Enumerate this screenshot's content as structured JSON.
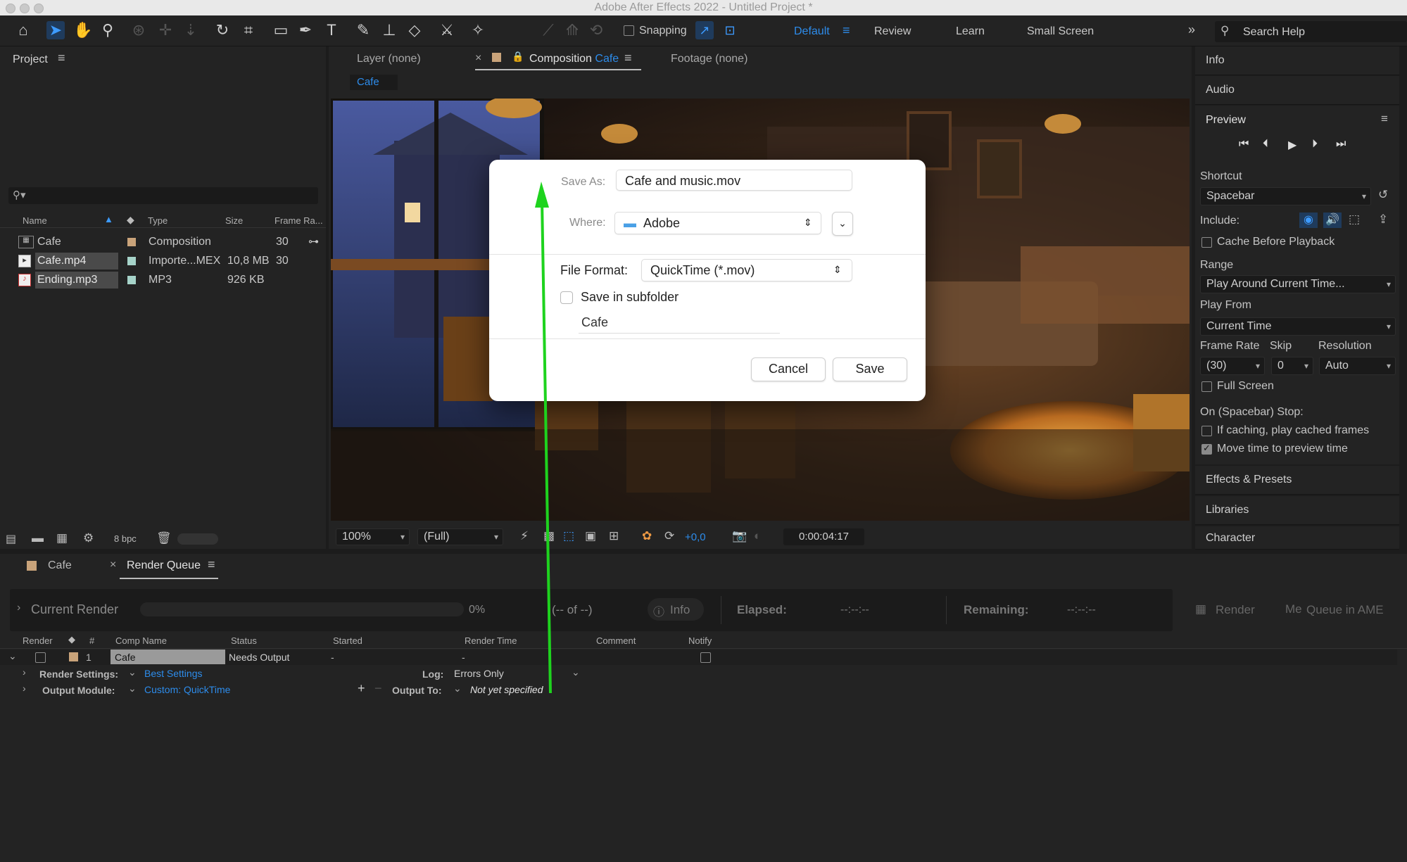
{
  "window": {
    "title": "Adobe After Effects 2022 - Untitled Project *"
  },
  "toolbar": {
    "snapping_label": "Snapping",
    "workspaces": [
      "Default",
      "Review",
      "Learn",
      "Small Screen"
    ],
    "search_placeholder": "Search Help",
    "overflow_icon": "double-chevron-right-icon"
  },
  "project_panel": {
    "title": "Project",
    "columns": [
      "Name",
      "Type",
      "Size",
      "Frame Ra..."
    ],
    "items": [
      {
        "name": "Cafe",
        "type": "Composition",
        "size": "",
        "fps": "30",
        "icon": "composition-icon",
        "color": "#c9a37a"
      },
      {
        "name": "Cafe.mp4",
        "type": "Importe...MEX",
        "size": "10,8 MB",
        "fps": "30",
        "icon": "video-file-icon",
        "color": "#a6d3c9"
      },
      {
        "name": "Ending.mp3",
        "type": "MP3",
        "size": "926 KB",
        "fps": "",
        "icon": "audio-file-icon",
        "color": "#a6d3c9"
      }
    ],
    "bpc": "8 bpc"
  },
  "viewer": {
    "tabs": {
      "layer": "Layer (none)",
      "composition_prefix": "Composition",
      "composition_name": "Cafe",
      "footage": "Footage (none)"
    },
    "breadcrumb": "Cafe",
    "zoom": "100%",
    "resolution": "(Full)",
    "exposure": "+0,0",
    "timecode": "0:00:04:17"
  },
  "right_panel": {
    "info": "Info",
    "audio": "Audio",
    "preview_title": "Preview",
    "shortcut_label": "Shortcut",
    "shortcut_value": "Spacebar",
    "include_label": "Include:",
    "cache_before_playback": "Cache Before Playback",
    "range_label": "Range",
    "range_value": "Play Around Current Time...",
    "play_from_label": "Play From",
    "play_from_value": "Current Time",
    "frame_rate_label": "Frame Rate",
    "skip_label": "Skip",
    "resolution_label": "Resolution",
    "frame_rate_value": "(30)",
    "skip_value": "0",
    "resolution_value": "Auto",
    "full_screen": "Full Screen",
    "on_stop_label": "On (Spacebar) Stop:",
    "if_caching": "If caching, play cached frames",
    "move_time": "Move time to preview time",
    "effects": "Effects & Presets",
    "libraries": "Libraries",
    "character": "Character"
  },
  "bottom_tabs": {
    "cafe": "Cafe",
    "render_queue": "Render Queue"
  },
  "render_queue": {
    "current_render": "Current Render",
    "progress": "0%",
    "of_label": "(-- of --)",
    "info_btn": "Info",
    "elapsed_label": "Elapsed:",
    "elapsed_value": "--:--:--",
    "remaining_label": "Remaining:",
    "remaining_value": "--:--:--",
    "render_btn": "Render",
    "queue_ame_btn": "Queue in AME",
    "columns": [
      "Render",
      "#",
      "Comp Name",
      "Status",
      "Started",
      "Render Time",
      "Comment",
      "Notify"
    ],
    "item": {
      "number": "1",
      "comp_name": "Cafe",
      "status": "Needs Output",
      "started": "-",
      "render_time": "-"
    },
    "render_settings_label": "Render Settings:",
    "render_settings_value": "Best Settings",
    "log_label": "Log:",
    "log_value": "Errors Only",
    "output_module_label": "Output Module:",
    "output_module_value": "Custom: QuickTime",
    "output_to_label": "Output To:",
    "output_to_value": "Not yet specified"
  },
  "save_dialog": {
    "save_as_label": "Save As:",
    "save_as_value": "Cafe and music.mov",
    "where_label": "Where:",
    "where_value": "Adobe",
    "file_format_label": "File Format:",
    "file_format_value": "QuickTime (*.mov)",
    "subfolder_label": "Save in subfolder",
    "subfolder_value": "Cafe",
    "cancel": "Cancel",
    "save": "Save"
  },
  "colors": {
    "accent_blue": "#2d8ceb",
    "arrow_green": "#1ed31e"
  }
}
